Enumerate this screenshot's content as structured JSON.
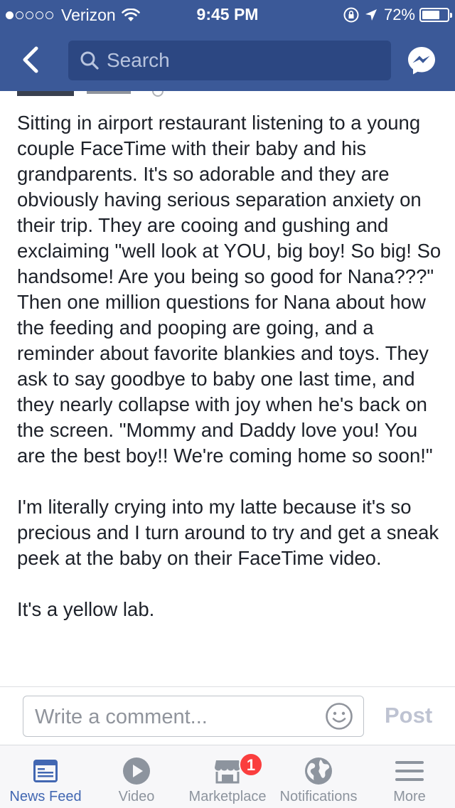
{
  "status_bar": {
    "carrier": "Verizon",
    "time": "9:45 PM",
    "battery_percent": "72%",
    "battery_level": 0.72,
    "signal_bars_filled": 1,
    "signal_bars_total": 5
  },
  "nav": {
    "search_placeholder": "Search"
  },
  "post": {
    "paragraphs": [
      "Sitting in airport restaurant listening to a young couple FaceTime with their baby and his grandparents. It's so adorable and they are obviously having serious separation anxiety on their trip. They are cooing and gushing and exclaiming \"well look at YOU, big boy! So big! So handsome! Are you being so good for Nana???\" Then one million questions for Nana about how the feeding and pooping are going, and a reminder about favorite blankies and toys. They ask to say goodbye to baby one last time, and they nearly collapse with joy when he's back on the screen. \"Mommy and Daddy love you! You are the best boy!! We're coming home so soon!\"",
      "I'm literally crying into my latte because it's so precious and I turn around to try and get a sneak peek at the baby on their FaceTime video.",
      "It's a yellow lab."
    ]
  },
  "comment_bar": {
    "placeholder": "Write a comment...",
    "post_label": "Post"
  },
  "tabs": [
    {
      "label": "News Feed",
      "icon": "news-feed-icon",
      "active": true
    },
    {
      "label": "Video",
      "icon": "video-play-icon",
      "active": false
    },
    {
      "label": "Marketplace",
      "icon": "marketplace-icon",
      "active": false,
      "badge": "1"
    },
    {
      "label": "Notifications",
      "icon": "globe-icon",
      "active": false
    },
    {
      "label": "More",
      "icon": "hamburger-menu-icon",
      "active": false
    }
  ],
  "colors": {
    "brand_blue": "#3b5998",
    "search_bg": "#2c4782",
    "active_tab": "#4267b2",
    "inactive_tab": "#8d949e",
    "badge_red": "#fa3e3e"
  }
}
